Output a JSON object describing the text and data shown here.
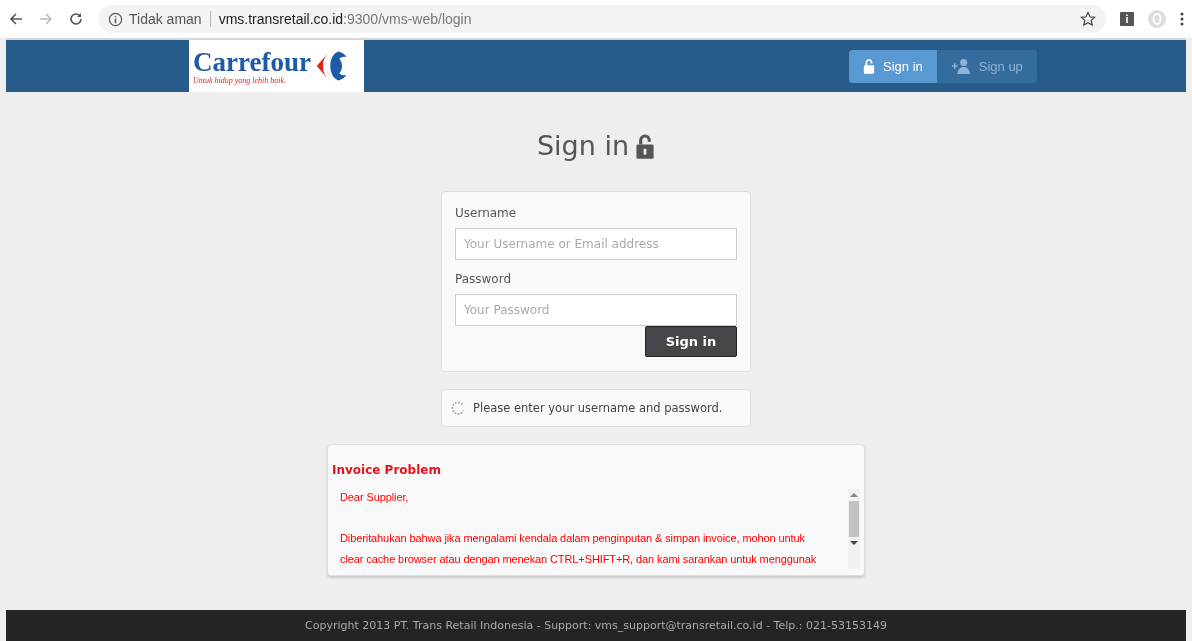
{
  "browser": {
    "security": "Tidak aman",
    "url_host": "vms.transretail.co.id",
    "url_path": ":9300/vms-web/login"
  },
  "header": {
    "brand": "Carrefour",
    "tagline": "Untuk hidup yang lebih baik.",
    "nav": [
      {
        "label": "Sign in",
        "kind": "lock",
        "selected": true
      },
      {
        "label": "Sign up",
        "kind": "user",
        "selected": false
      }
    ]
  },
  "title": "Sign in",
  "form": {
    "fields": [
      {
        "label": "Username",
        "placeholder": "Your Username or Email address"
      },
      {
        "label": "Password",
        "placeholder": "Your Password"
      }
    ],
    "submit": "Sign in"
  },
  "status": "Please enter your username and password.",
  "notice": {
    "title": "Invoice Problem",
    "paragraphs": [
      "Dear Supplier,",
      "Diberitahukan bahwa jika mengalami kendala dalam penginputan & simpan invoice, mohon untuk",
      "clear cache browser atau dengan menekan CTRL+SHIFT+R, dan kami sarankan untuk menggunak"
    ]
  },
  "footer": "Copyright 2013 PT. Trans Retail Indonesia - Support: vms_support@transretail.co.id - Telp.: 021-53153149"
}
